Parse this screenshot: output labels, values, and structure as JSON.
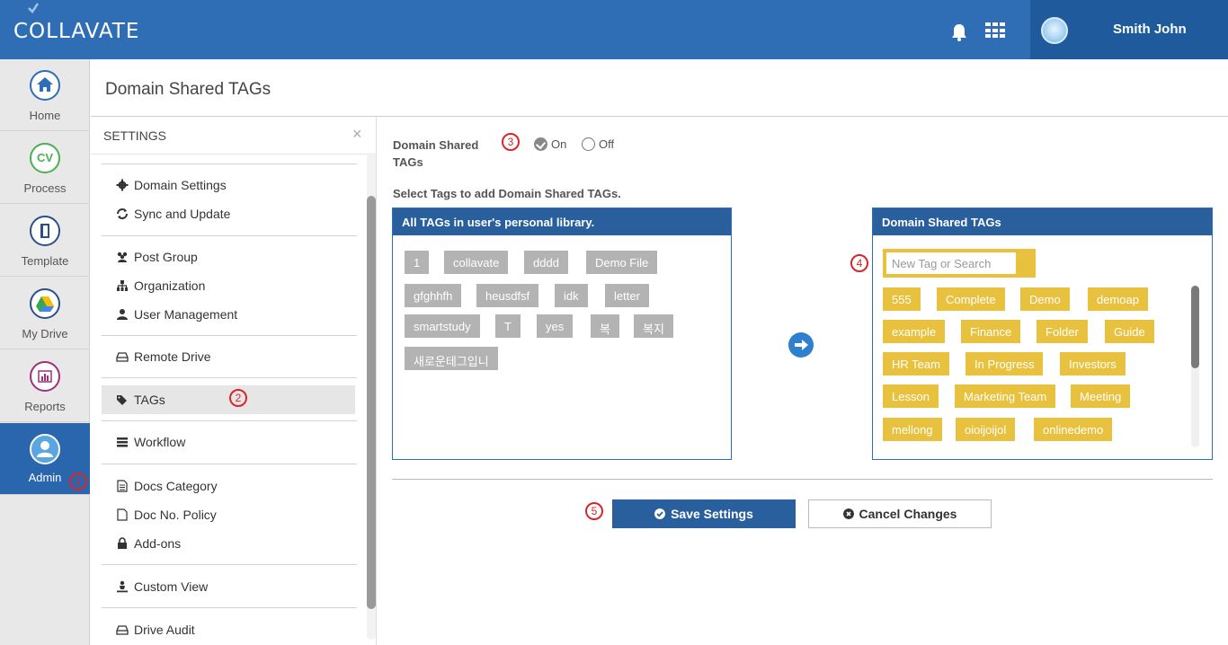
{
  "app": {
    "logo": "COLLAVATE",
    "user_name": "Smith John"
  },
  "leftnav": [
    {
      "label": "Home",
      "icon": "home-icon"
    },
    {
      "label": "Process",
      "icon_text": "CV"
    },
    {
      "label": "Template",
      "icon": "template-icon"
    },
    {
      "label": "My Drive",
      "icon": "drive-icon"
    },
    {
      "label": "Reports",
      "icon": "reports-icon"
    },
    {
      "label": "Admin",
      "icon": "admin-icon",
      "active": true
    }
  ],
  "page_title": "Domain Shared TAGs",
  "settings": {
    "title": "SETTINGS",
    "close": "×",
    "items": [
      {
        "label": "Domain Settings",
        "icon": "gear-icon"
      },
      {
        "label": "Sync and Update",
        "icon": "sync-icon"
      },
      {
        "label": "Post Group",
        "icon": "group-icon"
      },
      {
        "label": "Organization",
        "icon": "org-icon"
      },
      {
        "label": "User Management",
        "icon": "user-icon"
      },
      {
        "label": "Remote Drive",
        "icon": "drive-icon"
      },
      {
        "label": "TAGs",
        "icon": "tags-icon",
        "selected": true
      },
      {
        "label": "Workflow",
        "icon": "workflow-icon"
      },
      {
        "label": "Docs Category",
        "icon": "doc-icon"
      },
      {
        "label": "Doc No. Policy",
        "icon": "file-icon"
      },
      {
        "label": "Add-ons",
        "icon": "lock-icon"
      },
      {
        "label": "Custom View",
        "icon": "custom-view-icon"
      },
      {
        "label": "Drive Audit",
        "icon": "drive-icon"
      }
    ]
  },
  "badges": [
    "1",
    "2",
    "3",
    "4",
    "5"
  ],
  "toggle": {
    "label_line1": "Domain Shared",
    "label_line2": "TAGs",
    "on": "On",
    "off": "Off",
    "selected": "On"
  },
  "instruction": "Select Tags to add Domain Shared TAGs.",
  "left_panel": {
    "title": "All TAGs in user's personal library.",
    "tags": [
      "1",
      "collavate",
      "dddd",
      "Demo File",
      "gfghhfh",
      "heusdfsf",
      "idk",
      "letter",
      "smartstudy",
      "T",
      "yes",
      "복",
      "복지",
      "새로운테그입니"
    ]
  },
  "right_panel": {
    "title": "Domain Shared TAGs",
    "search_placeholder": "New Tag or Search",
    "tags": [
      "555",
      "Complete",
      "Demo",
      "demoap",
      "example",
      "Finance",
      "Folder",
      "Guide",
      "HR Team",
      "In Progress",
      "Investors",
      "Lesson",
      "Marketing Team",
      "Meeting",
      "mellong",
      "oioijoijol",
      "onlinedemo"
    ]
  },
  "buttons": {
    "save": "Save Settings",
    "cancel": "Cancel Changes"
  },
  "colors": {
    "header": "#2f6eb5",
    "panel_head": "#2a5f9e",
    "tag_gray": "#b3b3b3",
    "tag_yellow": "#e8c13f",
    "badge_red": "#d9262b"
  }
}
